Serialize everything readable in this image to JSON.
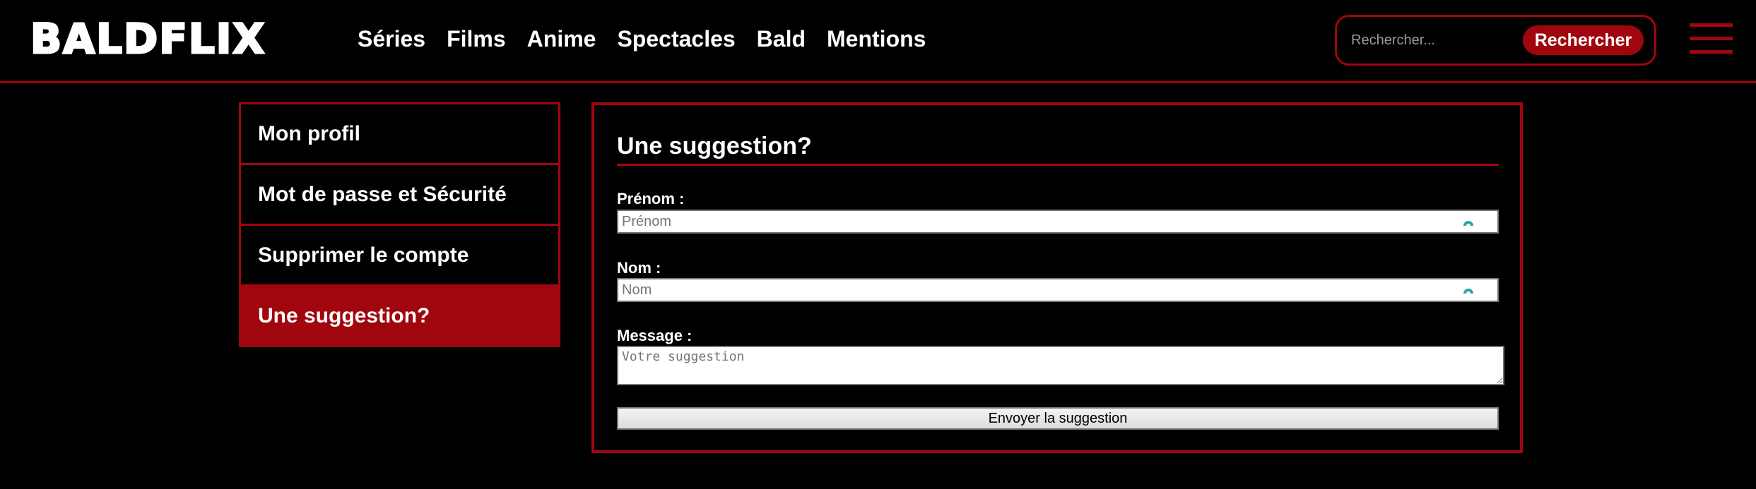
{
  "header": {
    "logo": "BALDFLIX",
    "nav": [
      "Séries",
      "Films",
      "Anime",
      "Spectacles",
      "Bald",
      "Mentions"
    ],
    "search": {
      "placeholder": "Rechercher...",
      "button_label": "Rechercher"
    },
    "menu_icon": "hamburger-menu-icon"
  },
  "sidebar": {
    "items": [
      {
        "label": "Mon profil",
        "active": false
      },
      {
        "label": "Mot de passe et Sécurité",
        "active": false
      },
      {
        "label": "Supprimer le compte",
        "active": false
      },
      {
        "label": "Une suggestion?",
        "active": true
      }
    ]
  },
  "form": {
    "title": "Une suggestion?",
    "first_name": {
      "label": "Prénom :",
      "placeholder": "Prénom",
      "value": ""
    },
    "last_name": {
      "label": "Nom :",
      "placeholder": "Nom",
      "value": ""
    },
    "message": {
      "label": "Message :",
      "placeholder": "Votre suggestion",
      "value": ""
    },
    "submit_label": "Envoyer la suggestion"
  },
  "colors": {
    "background": "#000000",
    "accent": "#a0060d",
    "text": "#ffffff",
    "autofill_icon": "#2aa6a0"
  }
}
